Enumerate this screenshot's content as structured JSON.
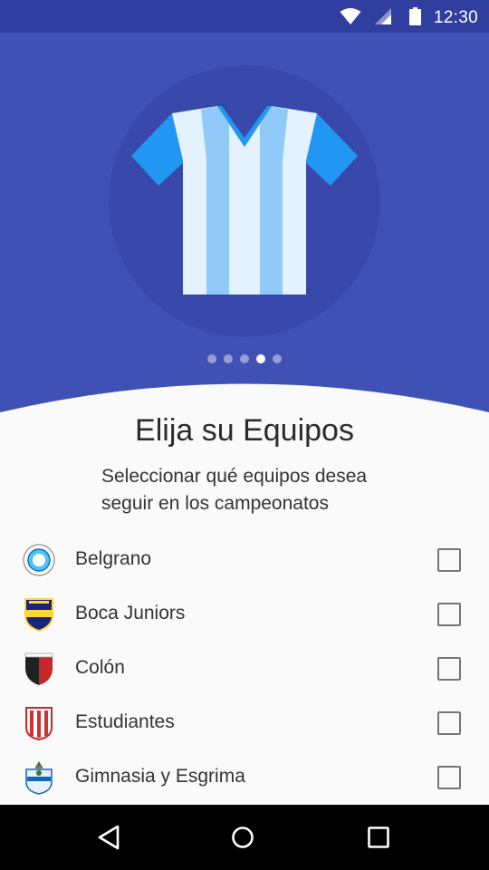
{
  "status_bar": {
    "time": "12:30",
    "icons": [
      "wifi-icon",
      "signal-icon",
      "battery-icon"
    ]
  },
  "onboarding": {
    "illustration": "football-jersey",
    "page_indicator": {
      "total": 5,
      "current": 4
    }
  },
  "main": {
    "title": "Elija su Equipos",
    "subtitle_line1": "Seleccionar qué equipos desea",
    "subtitle_line2": "seguir en los campeonatos"
  },
  "teams": [
    {
      "name": "Belgrano",
      "crest": "belgrano-crest-icon",
      "checked": false
    },
    {
      "name": "Boca Juniors",
      "crest": "boca-juniors-crest-icon",
      "checked": false
    },
    {
      "name": "Colón",
      "crest": "colon-crest-icon",
      "checked": false
    },
    {
      "name": "Estudiantes",
      "crest": "estudiantes-crest-icon",
      "checked": false
    },
    {
      "name": "Gimnasia y Esgrima",
      "crest": "gimnasia-crest-icon",
      "checked": false
    }
  ],
  "nav_bar": {
    "buttons": [
      "back-icon",
      "home-icon",
      "recents-icon"
    ]
  },
  "colors": {
    "primary": "#3f51b5",
    "primary_dark": "#303f9f",
    "circle": "#3949ab",
    "background": "#fafafa",
    "jersey_light": "#e3f2fd",
    "jersey_stripe": "#90caf9",
    "jersey_sleeve": "#2196f3"
  }
}
